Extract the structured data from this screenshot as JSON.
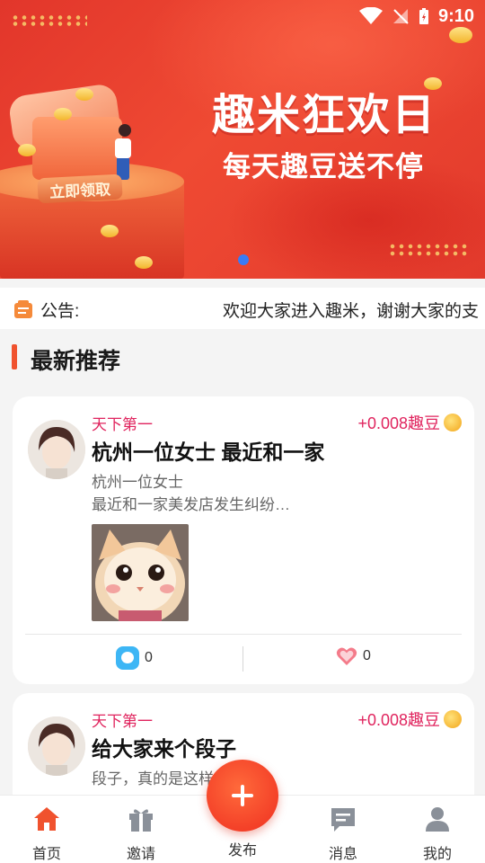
{
  "status_bar": {
    "time": "9:10"
  },
  "banner": {
    "title": "趣米狂欢日",
    "subtitle": "每天趣豆送不停",
    "cta": "立即领取"
  },
  "notice": {
    "label": "公告:",
    "text": "欢迎大家进入趣米，谢谢大家的支"
  },
  "section": {
    "title": "最新推荐"
  },
  "posts": [
    {
      "author": "天下第一",
      "reward": "+0.008趣豆",
      "title": "杭州一位女士 最近和一家",
      "lines": [
        "杭州一位女士",
        "最近和一家美发店发生纠纷…"
      ],
      "comments": "0",
      "likes": "0"
    },
    {
      "author": "天下第一",
      "reward": "+0.008趣豆",
      "title": "给大家来个段子",
      "lines": [
        "段子，真的是这样"
      ]
    }
  ],
  "nav": {
    "home": "首页",
    "invite": "邀请",
    "post": "发布",
    "messages": "消息",
    "me": "我的"
  },
  "colors": {
    "accent": "#f0522e",
    "author": "#e0245e",
    "banner": "#e2362b",
    "nav_active": "#f0522e"
  }
}
